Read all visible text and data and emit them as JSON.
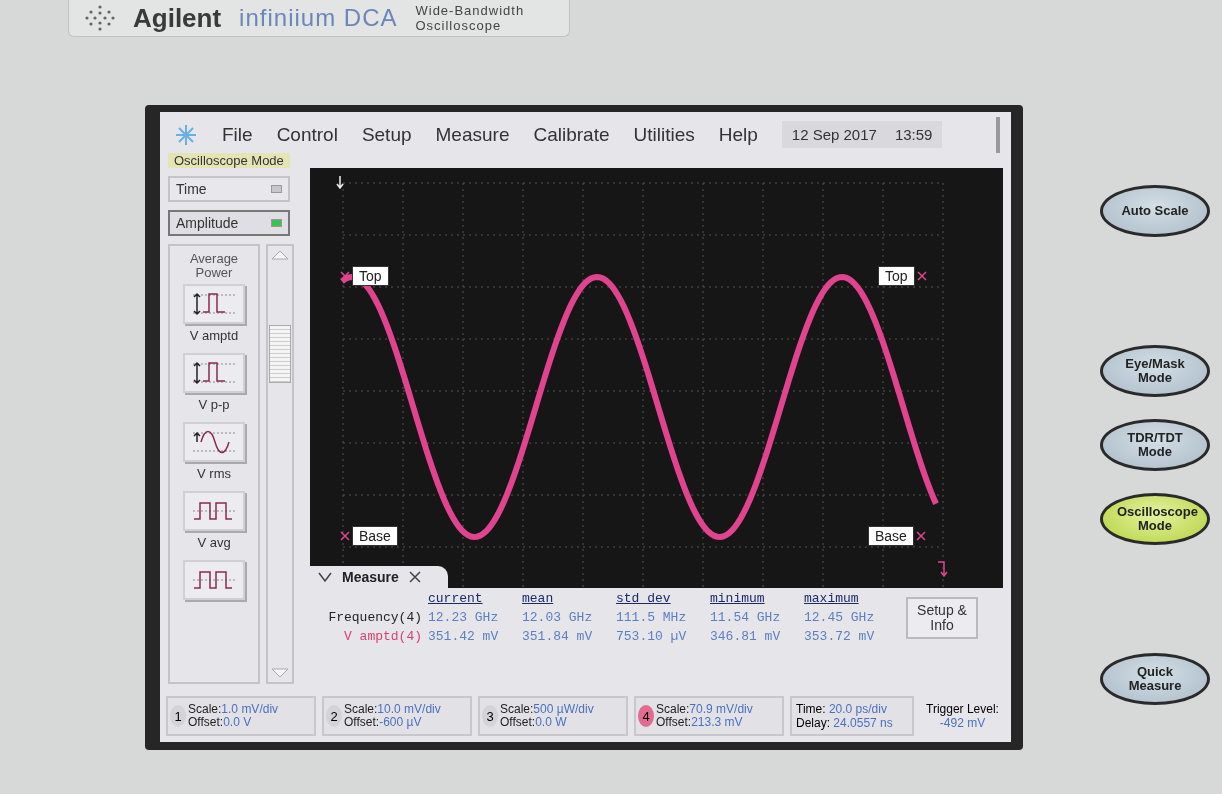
{
  "instrument": {
    "brand": "Agilent",
    "product": "infiniium DCA",
    "description": [
      "Wide-Bandwidth",
      "Oscilloscope"
    ]
  },
  "menu": {
    "items": [
      "File",
      "Control",
      "Setup",
      "Measure",
      "Calibrate",
      "Utilities",
      "Help"
    ],
    "date": "12 Sep 2017",
    "time": "13:59"
  },
  "mode_label": "Oscilloscope Mode",
  "sidebar": {
    "tabs": [
      {
        "label": "Time",
        "selected": false
      },
      {
        "label": "Amplitude",
        "selected": true
      }
    ],
    "group_title": "Average Power",
    "measurements": [
      {
        "label": "V amptd",
        "kind": "amptd"
      },
      {
        "label": "V p-p",
        "kind": "pp"
      },
      {
        "label": "V rms",
        "kind": "rms"
      },
      {
        "label": "V avg",
        "kind": "avg"
      },
      {
        "kind": "duty"
      }
    ]
  },
  "plot": {
    "markers": [
      {
        "label": "Top",
        "kind": "top_left"
      },
      {
        "label": "Top",
        "kind": "top_right"
      },
      {
        "label": "Base",
        "kind": "base_left"
      },
      {
        "label": "Base",
        "kind": "base_right"
      }
    ]
  },
  "measure_panel": {
    "title": "Measure",
    "columns": [
      "current",
      "mean",
      "std dev",
      "minimum",
      "maximum"
    ],
    "rows": [
      {
        "label": "Frequency(4)",
        "color": "#222222",
        "values": [
          "12.23 GHz",
          "12.03 GHz",
          "111.5 MHz",
          "11.54 GHz",
          "12.45 GHz"
        ]
      },
      {
        "label": "V amptd(4)",
        "color": "#d8406e",
        "values": [
          "351.42 mV",
          "351.84 mV",
          "753.10 µV",
          "346.81 mV",
          "353.72 mV"
        ]
      }
    ],
    "button": "Setup & Info"
  },
  "channels": [
    {
      "number": "1",
      "on": false,
      "scale_label": "Scale:",
      "scale": "1.0 mV/div",
      "offset_label": "Offset:",
      "offset": "0.0 V"
    },
    {
      "number": "2",
      "on": false,
      "scale_label": "Scale:",
      "scale": "10.0 mV/div",
      "offset_label": "Offset:",
      "offset": "-600 µV"
    },
    {
      "number": "3",
      "on": false,
      "scale_label": "Scale:",
      "scale": "500 µW/div",
      "offset_label": "Offset:",
      "offset": "0.0 W"
    },
    {
      "number": "4",
      "on": true,
      "scale_label": "Scale:",
      "scale": "70.9 mV/div",
      "offset_label": "Offset:",
      "offset": "213.3 mV"
    }
  ],
  "timebase": {
    "time_label": "Time:",
    "time": "20.0 ps/div",
    "delay_label": "Delay:",
    "delay": "24.0557 ns"
  },
  "trigger": {
    "label": "Trigger Level:",
    "value": "-492 mV"
  },
  "front_buttons": [
    [
      {
        "label": "Auto Scale",
        "lit": false
      }
    ],
    [
      {
        "label": "Eye/Mask Mode",
        "lit": false
      },
      {
        "label": "TDR/TDT Mode",
        "lit": false
      },
      {
        "label": "Oscilloscope Mode",
        "lit": true
      }
    ],
    [
      {
        "label": "Quick Measure",
        "lit": false
      }
    ]
  ]
}
